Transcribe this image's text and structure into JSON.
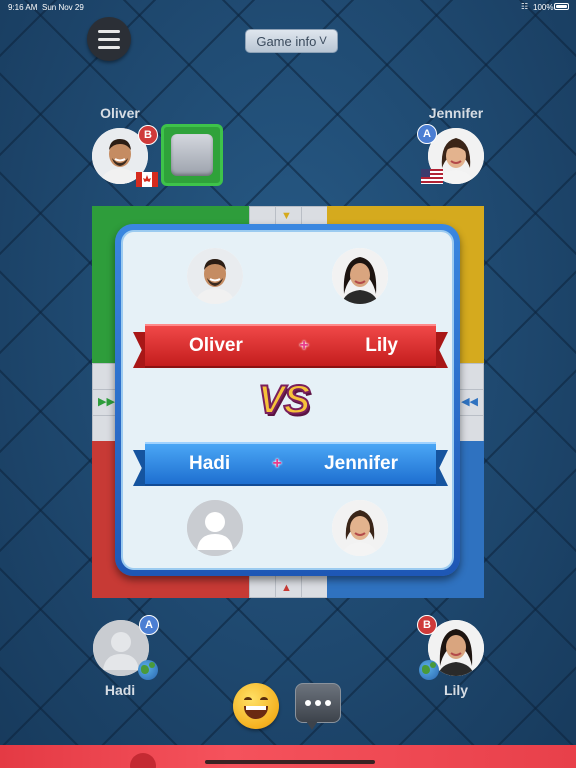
{
  "status_bar": {
    "time": "9:16 AM",
    "date": "Sun Nov 29",
    "battery": "100%"
  },
  "header": {
    "game_info_label": "Game info",
    "game_info_chevron": "V"
  },
  "players": {
    "top_left": {
      "name": "Oliver",
      "team": "B",
      "country": "Canada"
    },
    "top_right": {
      "name": "Jennifer",
      "team": "A",
      "country": "USA"
    },
    "bottom_left": {
      "name": "Hadi",
      "team": "A",
      "country": "globe"
    },
    "bottom_right": {
      "name": "Lily",
      "team": "B",
      "country": "globe"
    }
  },
  "vs_modal": {
    "team_red": {
      "player1": "Oliver",
      "player2": "Lily",
      "joiner": "+"
    },
    "vs_text": "VS",
    "team_blue": {
      "player1": "Hadi",
      "player2": "Jennifer",
      "joiner": "+"
    }
  },
  "colors": {
    "green": "#2e9d3b",
    "yellow": "#d5aa1e",
    "red": "#c73a35",
    "blue": "#2f72c0"
  }
}
